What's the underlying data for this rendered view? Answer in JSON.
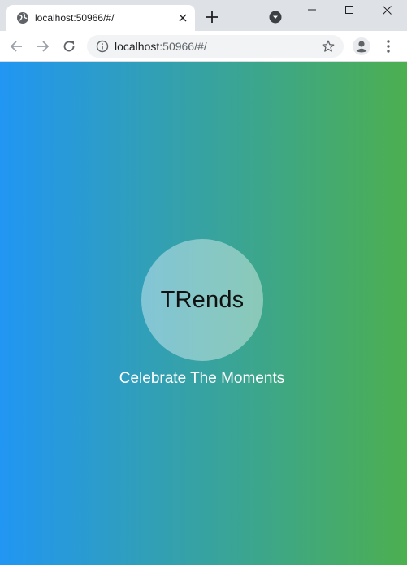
{
  "browser": {
    "tab": {
      "title": "localhost:50966/#/"
    },
    "address": {
      "host": "localhost",
      "rest": ":50966/#/"
    }
  },
  "page": {
    "logo_text": "TRends",
    "tagline": "Celebrate The Moments"
  }
}
